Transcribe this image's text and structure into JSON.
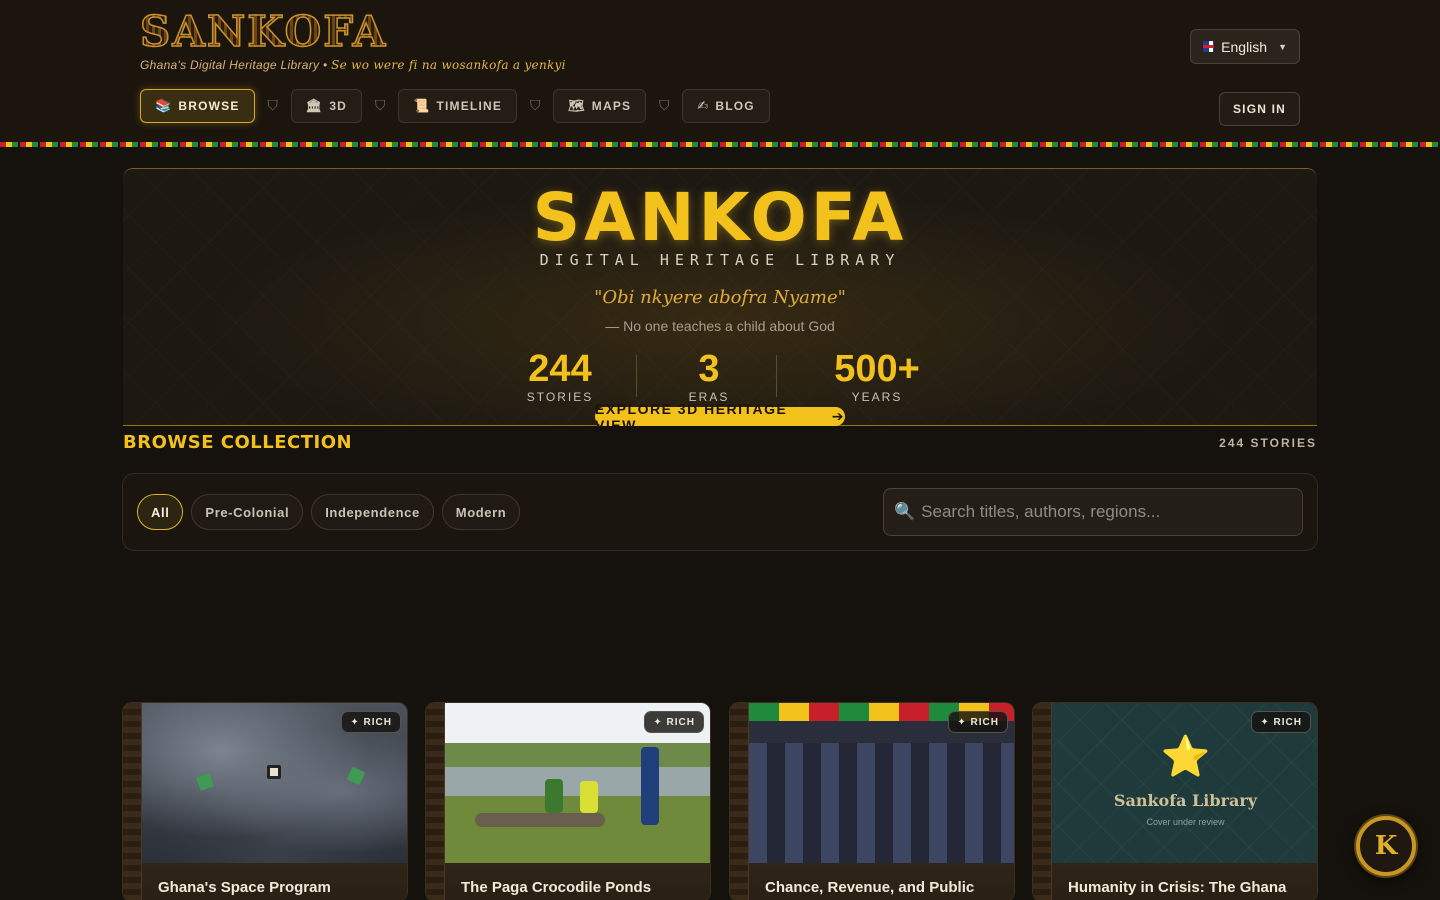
{
  "header": {
    "logo": "SANKOFA",
    "tagline": "Ghana's Digital Heritage Library •",
    "tagline_proverb": "Se wo were fi na wosankofa a yenkyi",
    "language": "English",
    "sign_in": "SIGN IN"
  },
  "nav": {
    "items": [
      {
        "icon": "📚",
        "label": "BROWSE"
      },
      {
        "icon": "🏛",
        "label": "3D"
      },
      {
        "icon": "📜",
        "label": "TIMELINE"
      },
      {
        "icon": "🗺",
        "label": "MAPS"
      },
      {
        "icon": "✍",
        "label": "BLOG"
      }
    ],
    "separator": "⛉"
  },
  "hero": {
    "title": "SANKOFA",
    "subtitle": "DIGITAL HERITAGE LIBRARY",
    "proverb": "\"Obi nkyere abofra Nyame\"",
    "translation": "— No one teaches a child about God",
    "stats": [
      {
        "value": "244",
        "label": "STORIES"
      },
      {
        "value": "3",
        "label": "ERAS"
      },
      {
        "value": "500+",
        "label": "YEARS"
      }
    ],
    "cta": "EXPLORE 3D HERITAGE VIEW",
    "cta_arrow": "➔"
  },
  "browse": {
    "title": "BROWSE COLLECTION",
    "count": "244 STORIES",
    "filters": [
      "All",
      "Pre-Colonial",
      "Independence",
      "Modern"
    ],
    "active_filter": "All",
    "search_placeholder": "Search titles, authors, regions..."
  },
  "cards": [
    {
      "title": "Ghana's Space Program",
      "badge": "✦ RICH"
    },
    {
      "title": "The Paga Crocodile Ponds",
      "badge": "✦ RICH"
    },
    {
      "title": "Chance, Revenue, and Public",
      "badge": "✦ RICH"
    },
    {
      "title": "Humanity in Crisis: The Ghana",
      "badge": "✦ RICH"
    }
  ],
  "placeholder_cover": {
    "star": "⭐",
    "title": "Sankofa Library",
    "note": "Cover under review"
  },
  "floating_badge": "K",
  "colors": {
    "accent": "#f2c11c",
    "background": "#15110c",
    "kente_red": "#c8202a",
    "kente_gold": "#f0c21a",
    "kente_green": "#1e8a3c"
  }
}
